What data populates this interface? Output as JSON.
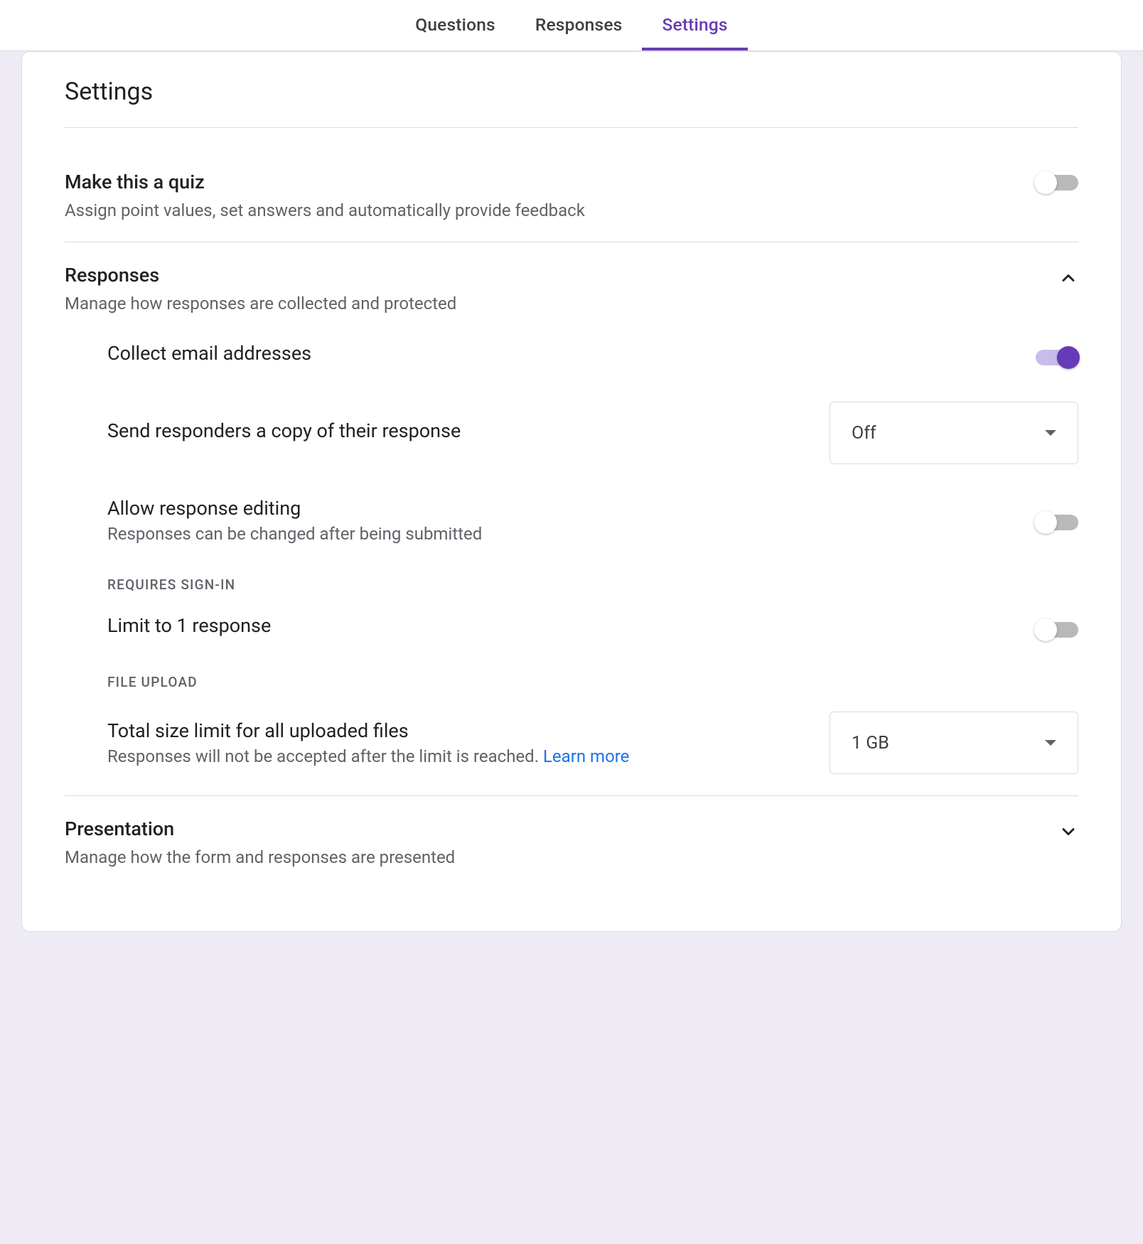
{
  "tabs": {
    "questions": "Questions",
    "responses": "Responses",
    "settings": "Settings"
  },
  "page_title": "Settings",
  "quiz": {
    "title": "Make this a quiz",
    "sub": "Assign point values, set answers and automatically provide feedback"
  },
  "responses": {
    "title": "Responses",
    "sub": "Manage how responses are collected and protected",
    "collect_email": "Collect email addresses",
    "send_copy": {
      "label": "Send responders a copy of their response",
      "value": "Off"
    },
    "allow_edit": {
      "title": "Allow response editing",
      "sub": "Responses can be changed after being submitted"
    },
    "signin_header": "REQUIRES SIGN-IN",
    "limit_one": "Limit to 1 response",
    "upload_header": "FILE UPLOAD",
    "total_size": {
      "title": "Total size limit for all uploaded files",
      "sub": "Responses will not be accepted after the limit is reached. ",
      "learn": "Learn more",
      "value": "1 GB"
    }
  },
  "presentation": {
    "title": "Presentation",
    "sub": "Manage how the form and responses are presented"
  }
}
